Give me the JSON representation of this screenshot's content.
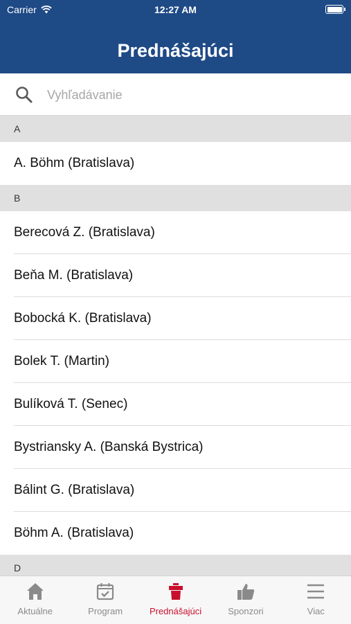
{
  "status_bar": {
    "carrier": "Carrier",
    "time": "12:27 AM"
  },
  "header": {
    "title": "Prednášajúci"
  },
  "search": {
    "placeholder": "Vyhľadávanie"
  },
  "sections": [
    {
      "letter": "A",
      "items": [
        "A. Böhm (Bratislava)"
      ]
    },
    {
      "letter": "B",
      "items": [
        "Berecová Z. (Bratislava)",
        "Beňa M. (Bratislava)",
        "Bobocká K. (Bratislava)",
        "Bolek T. (Martin)",
        "Bulíková T. (Senec)",
        "Bystriansky A. (Banská Bystrica)",
        "Bálint G. (Bratislava)",
        "Böhm A. (Bratislava)"
      ]
    },
    {
      "letter": "D",
      "items": []
    }
  ],
  "tabs": [
    {
      "label": "Aktuálne",
      "icon": "home-icon"
    },
    {
      "label": "Program",
      "icon": "calendar-icon"
    },
    {
      "label": "Prednášajúci",
      "icon": "podium-icon",
      "active": true
    },
    {
      "label": "Sponzori",
      "icon": "thumbs-up-icon"
    },
    {
      "label": "Viac",
      "icon": "menu-icon"
    }
  ],
  "colors": {
    "header_bg": "#1e4a86",
    "active_tab": "#c8102e",
    "inactive_tab": "#8a8a8a",
    "section_bg": "#e0e0e0"
  }
}
